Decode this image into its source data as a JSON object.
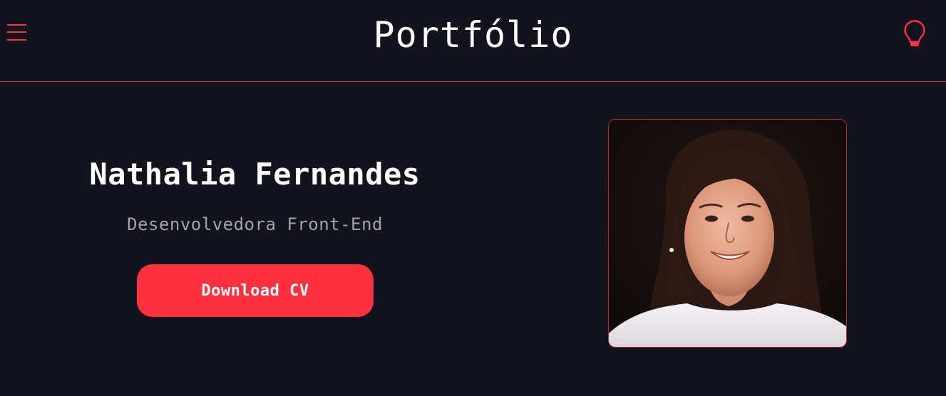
{
  "header": {
    "title": "Portfólio",
    "menu_icon": "hamburger-menu-icon",
    "theme_icon": "lightbulb-icon"
  },
  "hero": {
    "name": "Nathalia Fernandes",
    "role": "Desenvolvedora Front-End",
    "cv_button_label": "Download CV"
  },
  "colors": {
    "background": "#13131e",
    "accent": "#ff3140",
    "divider": "#e0303f",
    "title_text": "#ffffff",
    "subtitle_text": "#a3a3aa"
  }
}
